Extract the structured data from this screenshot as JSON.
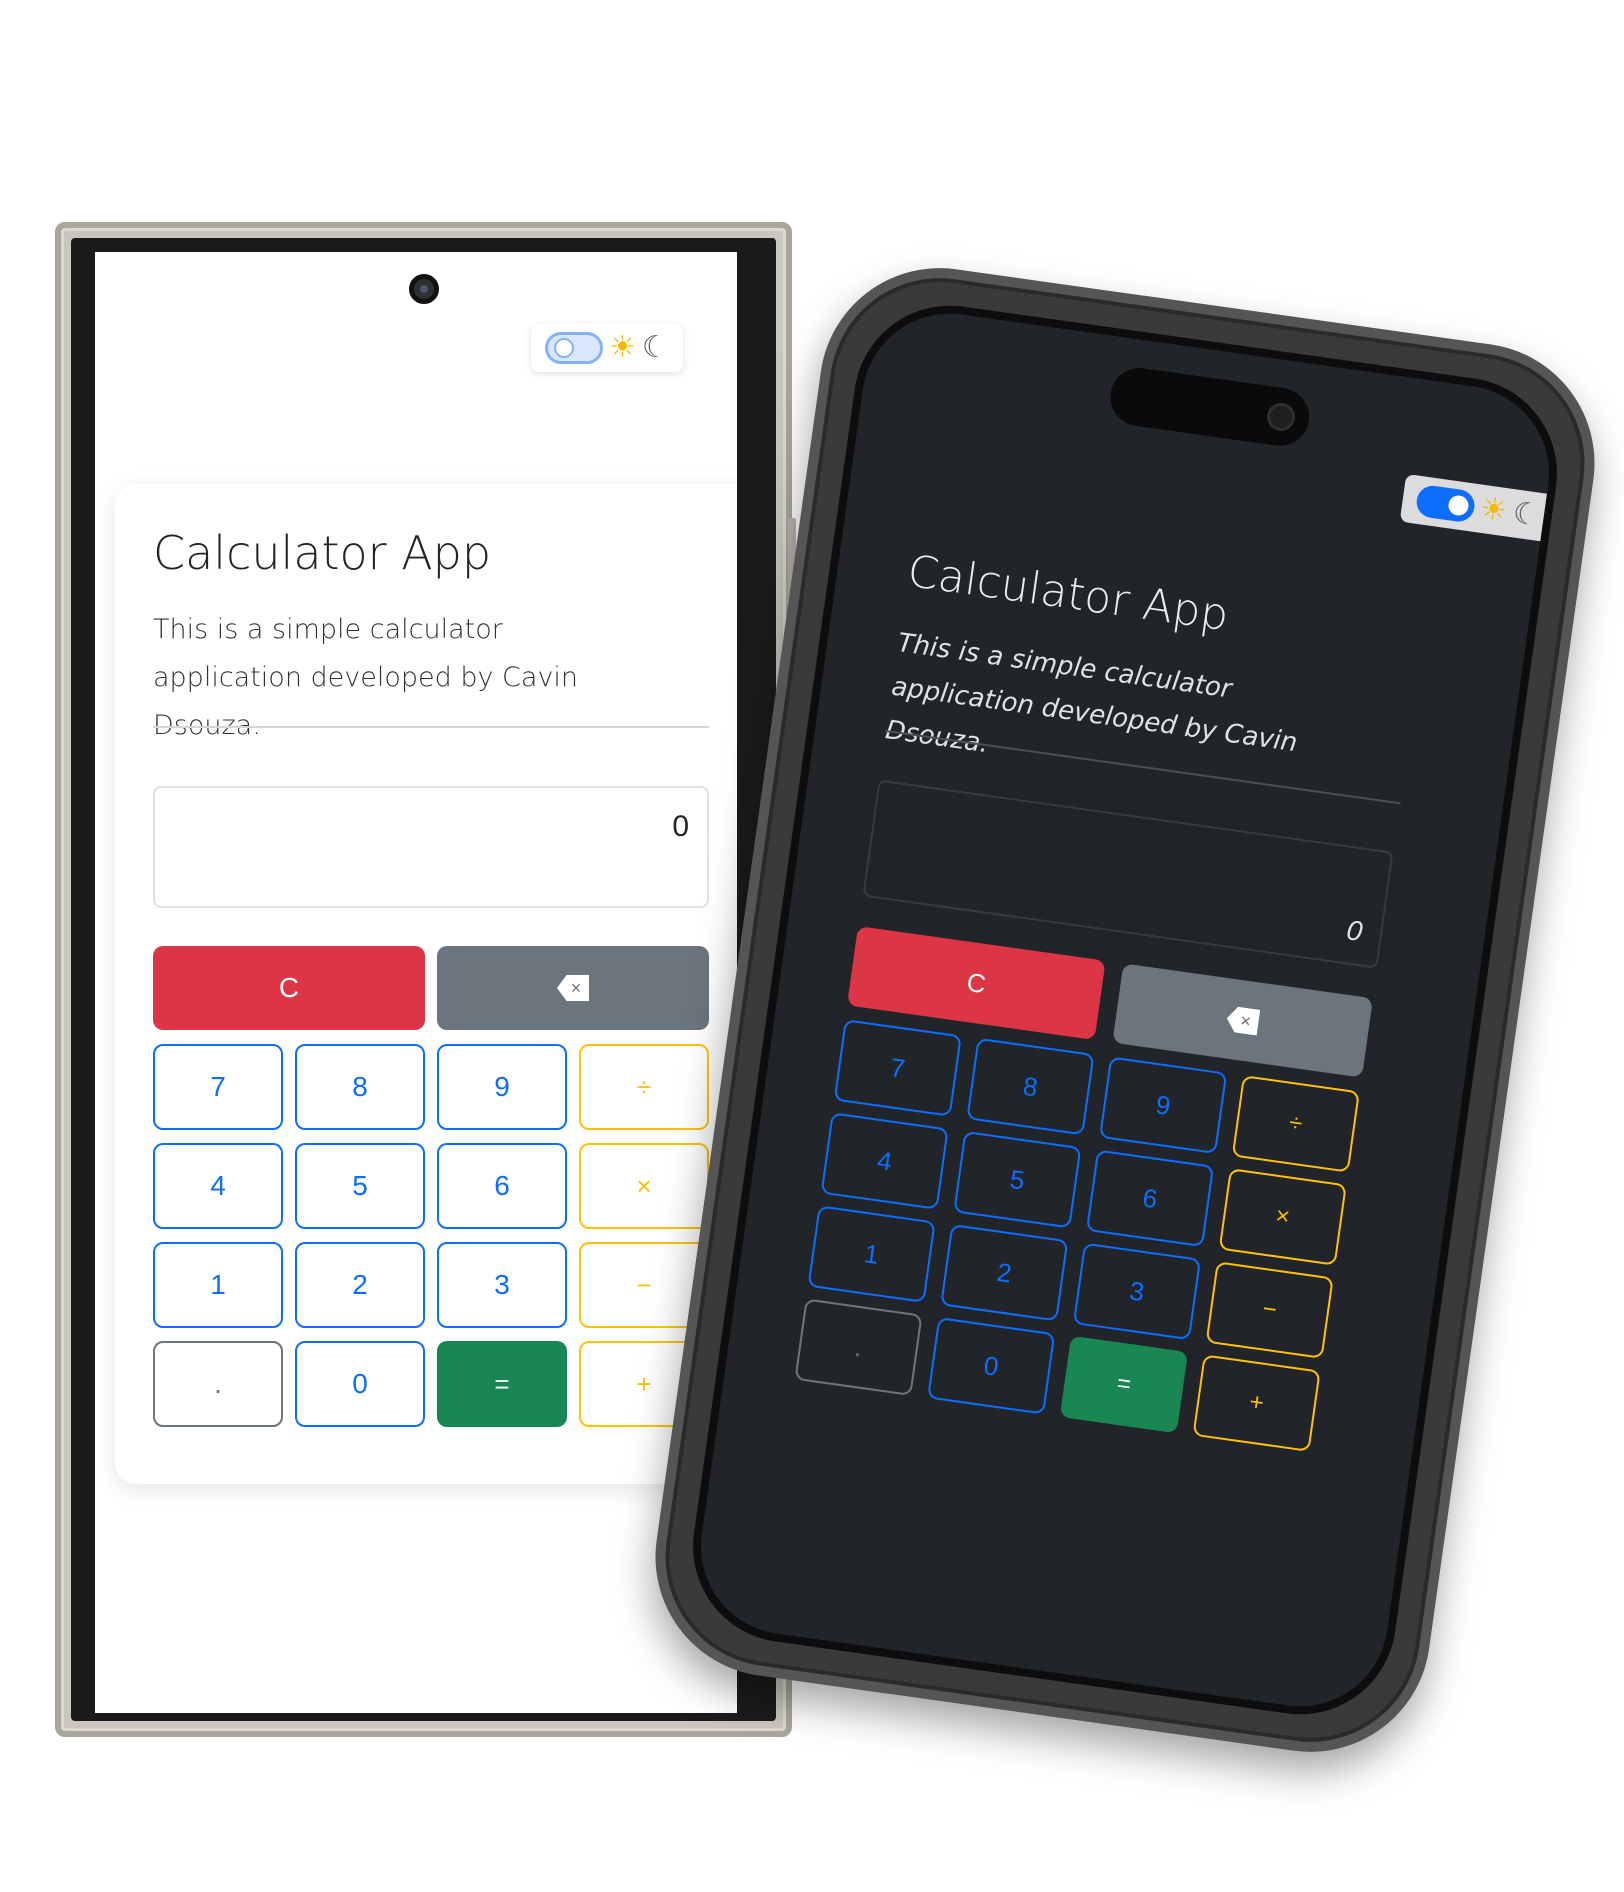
{
  "app": {
    "title": "Calculator App",
    "description": "This is a simple calculator application developed by Cavin Dsouza.",
    "display_value": "0"
  },
  "theme_toggle": {
    "sun_icon": "☀",
    "moon_icon": "☾"
  },
  "buttons": {
    "clear": "C",
    "backspace_icon": "backspace-icon",
    "backspace_glyph": "×",
    "row1": [
      "7",
      "8",
      "9",
      "÷"
    ],
    "row2": [
      "4",
      "5",
      "6",
      "×"
    ],
    "row3": [
      "1",
      "2",
      "3",
      "−"
    ],
    "row4": [
      ".",
      "0",
      "=",
      "+"
    ]
  },
  "colors": {
    "danger": "#dc3545",
    "secondary": "#6c757d",
    "primary": "#0d6efd",
    "warning": "#ffc107",
    "success": "#198754",
    "dark_bg": "#212529"
  },
  "themes": {
    "light": "light",
    "dark": "dark"
  }
}
